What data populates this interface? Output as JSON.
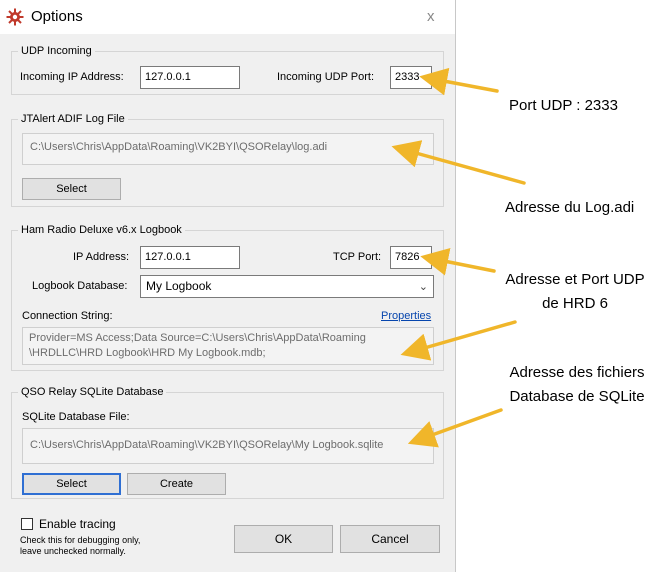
{
  "window": {
    "title": "Options",
    "close": "x"
  },
  "udp": {
    "legend": "UDP Incoming",
    "ip_label": "Incoming IP Address:",
    "ip_value": "127.0.0.1",
    "port_label": "Incoming UDP Port:",
    "port_value": "2333"
  },
  "jtalert": {
    "legend": "JTAlert ADIF Log File",
    "path": "C:\\Users\\Chris\\AppData\\Roaming\\VK2BYI\\QSORelay\\log.adi",
    "select_label": "Select"
  },
  "hrd": {
    "legend": "Ham Radio Deluxe v6.x Logbook",
    "ip_label": "IP Address:",
    "ip_value": "127.0.0.1",
    "port_label": "TCP Port:",
    "port_value": "7826",
    "db_label": "Logbook Database:",
    "db_value": "My Logbook",
    "conn_label": "Connection String:",
    "properties_label": "Properties",
    "conn_line1": "Provider=MS Access;Data Source=C:\\Users\\Chris\\AppData\\Roaming",
    "conn_line2": "\\HRDLLC\\HRD Logbook\\HRD My Logbook.mdb;"
  },
  "sqlite": {
    "legend": "QSO Relay SQLite Database",
    "file_label": "SQLite Database File:",
    "path": "C:\\Users\\Chris\\AppData\\Roaming\\VK2BYI\\QSORelay\\My Logbook.sqlite",
    "select_label": "Select",
    "create_label": "Create"
  },
  "footer": {
    "tracing_label": "Enable tracing",
    "tracing_note1": "Check this for debugging only,",
    "tracing_note2": "leave unchecked normally.",
    "ok_label": "OK",
    "cancel_label": "Cancel"
  },
  "annotations": {
    "port_udp": "Port UDP : 2333",
    "adresse_log": "Adresse du Log.adi",
    "hrd_line1": "Adresse et Port UDP",
    "hrd_line2": "de HRD 6",
    "sqlite_line1": "Adresse des fichiers",
    "sqlite_line2": "Database de SQLite"
  },
  "colors": {
    "arrow": "#f0b62a",
    "link": "#0645ad",
    "focus": "#2f6fd3"
  },
  "icons": {
    "title": "gear-icon",
    "dropdown": "chevron-down-icon",
    "arrows": "arrow-left-icon"
  }
}
